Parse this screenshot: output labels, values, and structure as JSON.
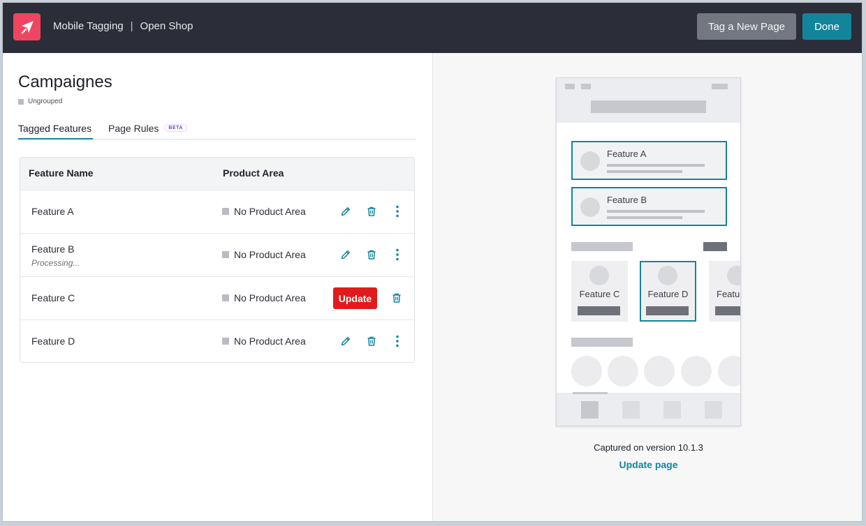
{
  "header": {
    "app_name": "Mobile Tagging",
    "separator": "|",
    "app_title": "Open Shop",
    "tag_new_page_label": "Tag a New Page",
    "done_label": "Done"
  },
  "page": {
    "title": "Campaignes",
    "group": "Ungrouped"
  },
  "tabs": [
    {
      "label": "Tagged Features",
      "active": true
    },
    {
      "label": "Page Rules",
      "badge": "BETA",
      "active": false
    }
  ],
  "table": {
    "columns": [
      "Feature Name",
      "Product Area"
    ],
    "rows": [
      {
        "name": "Feature A",
        "status": "",
        "area": "No Product Area",
        "needs_update": false
      },
      {
        "name": "Feature B",
        "status": "Processing...",
        "area": "No Product Area",
        "needs_update": false
      },
      {
        "name": "Feature C",
        "status": "",
        "area": "No Product Area",
        "needs_update": true,
        "update_label": "Update"
      },
      {
        "name": "Feature D",
        "status": "",
        "area": "No Product Area",
        "needs_update": false
      }
    ]
  },
  "preview": {
    "cards": [
      "Feature A",
      "Feature B"
    ],
    "tiles": [
      "Feature C",
      "Feature D",
      "Featu"
    ],
    "captured_text": "Captured on version 10.1.3",
    "update_page_label": "Update page"
  },
  "colors": {
    "accent": "#12859b",
    "brand": "#ef4561",
    "danger": "#e01b1b",
    "topbar": "#2b2e38"
  }
}
